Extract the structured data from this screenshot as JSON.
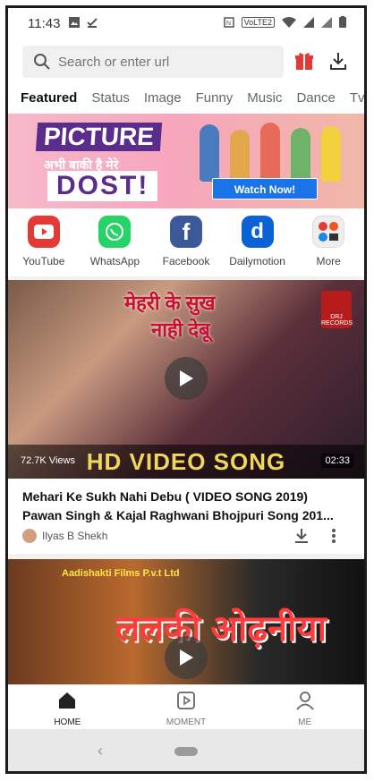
{
  "status_bar": {
    "time": "11:43",
    "network": "VoLTE2"
  },
  "search": {
    "placeholder": "Search or enter url"
  },
  "tabs": [
    {
      "label": "Featured",
      "active": true
    },
    {
      "label": "Status"
    },
    {
      "label": "Image"
    },
    {
      "label": "Funny"
    },
    {
      "label": "Music"
    },
    {
      "label": "Dance"
    },
    {
      "label": "Tvs"
    }
  ],
  "banner": {
    "title": "PICTURE",
    "subtitle": "अभी बाकी है मेरे",
    "word": "DOST!",
    "button": "Watch Now!"
  },
  "apps": [
    {
      "label": "YouTube",
      "color": "#e53935",
      "icon": "youtube-icon"
    },
    {
      "label": "WhatsApp",
      "color": "#25d366",
      "icon": "whatsapp-icon"
    },
    {
      "label": "Facebook",
      "color": "#3b5998",
      "icon": "facebook-icon"
    },
    {
      "label": "Dailymotion",
      "color": "#0b62d6",
      "icon": "dailymotion-icon"
    },
    {
      "label": "More",
      "color": "#eeeeee",
      "icon": "more-apps-icon"
    }
  ],
  "video1": {
    "overlay_title_1": "मेहरी के सुख",
    "overlay_title_2": "नाही देबू",
    "banner_text": "HD VIDEO SONG",
    "views": "72.7K Views",
    "duration": "02:33",
    "title": "Mehari Ke Sukh Nahi Debu ( VIDEO SONG 2019) Pawan Singh & Kajal Raghwani  Bhojpuri Song 201...",
    "author": "Ilyas B Shekh",
    "badge": "DRJ RECORDS"
  },
  "video2": {
    "top_text": "Aadishakti Films P.v.t Ltd",
    "big_text": "ललकी ओढ़नीया"
  },
  "bottom_nav": [
    {
      "label": "HOME",
      "active": true
    },
    {
      "label": "MOMENT"
    },
    {
      "label": "ME"
    }
  ],
  "colors": {
    "accent": "#e53935",
    "tab_active": "#111111"
  }
}
